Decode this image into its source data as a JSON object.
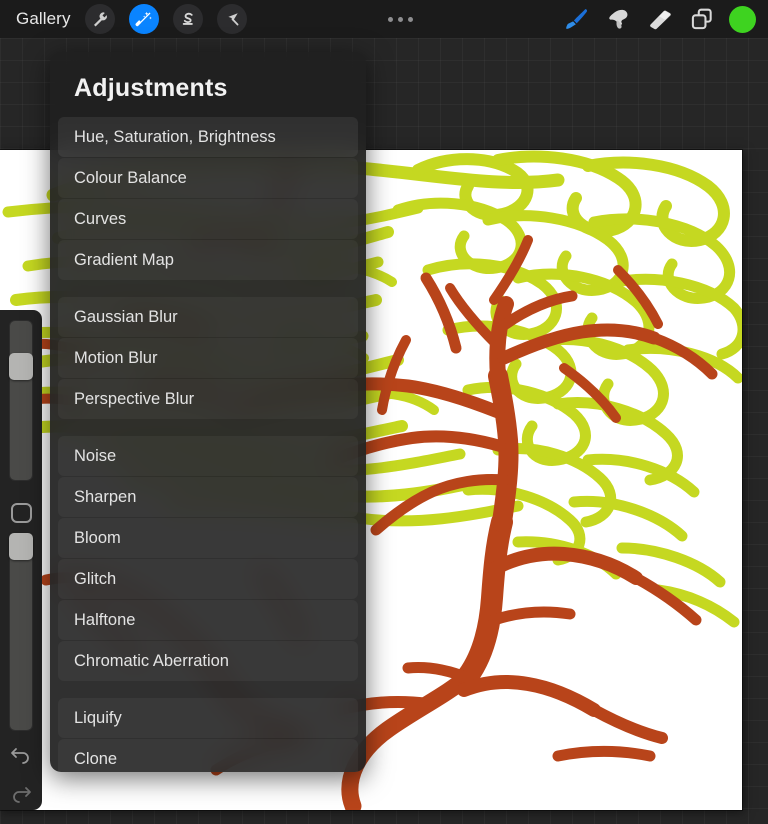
{
  "toolbar": {
    "gallery_label": "Gallery",
    "left_tools": [
      {
        "name": "wrench-icon",
        "label": "Actions",
        "active": false
      },
      {
        "name": "magic-wand-icon",
        "label": "Adjustments",
        "active": true
      },
      {
        "name": "selection-s-icon",
        "label": "Selection",
        "active": false
      },
      {
        "name": "transform-arrow-icon",
        "label": "Transform",
        "active": false
      }
    ],
    "more_label": "More",
    "right_tools": [
      {
        "name": "paintbrush-icon",
        "label": "Paint"
      },
      {
        "name": "smudge-icon",
        "label": "Smudge"
      },
      {
        "name": "eraser-icon",
        "label": "Erase"
      },
      {
        "name": "layers-icon",
        "label": "Layers"
      }
    ],
    "color_swatch": {
      "name": "color-swatch",
      "label": "Colour",
      "color": "#3ed320"
    }
  },
  "sidebar": {
    "brush_size": {
      "label": "Brush size",
      "value": 78
    },
    "brush_opacity": {
      "label": "Opacity",
      "value": 100
    },
    "modify_button": {
      "name": "modify-button",
      "label": "Modify"
    },
    "undo_button": {
      "name": "undo-icon",
      "label": "Undo"
    },
    "redo_button": {
      "name": "redo-icon",
      "label": "Redo"
    }
  },
  "panel": {
    "title": "Adjustments",
    "groups": [
      {
        "items": [
          {
            "label": "Hue, Saturation, Brightness",
            "highlight": true
          },
          {
            "label": "Colour Balance",
            "highlight": false
          },
          {
            "label": "Curves",
            "highlight": false
          },
          {
            "label": "Gradient Map",
            "highlight": false
          }
        ]
      },
      {
        "items": [
          {
            "label": "Gaussian Blur",
            "highlight": false
          },
          {
            "label": "Motion Blur",
            "highlight": false
          },
          {
            "label": "Perspective Blur",
            "highlight": false
          }
        ]
      },
      {
        "items": [
          {
            "label": "Noise",
            "highlight": false
          },
          {
            "label": "Sharpen",
            "highlight": false
          },
          {
            "label": "Bloom",
            "highlight": false
          },
          {
            "label": "Glitch",
            "highlight": false
          },
          {
            "label": "Halftone",
            "highlight": false
          },
          {
            "label": "Chromatic Aberration",
            "highlight": false
          }
        ]
      },
      {
        "items": [
          {
            "label": "Liquify",
            "highlight": false
          },
          {
            "label": "Clone",
            "highlight": false
          }
        ]
      }
    ]
  },
  "canvas": {
    "label": "Drawing canvas",
    "subject": "tree with foliage",
    "background": "#ffffff",
    "foliage_color": "#c5d821",
    "branch_color": "#b8441a"
  }
}
